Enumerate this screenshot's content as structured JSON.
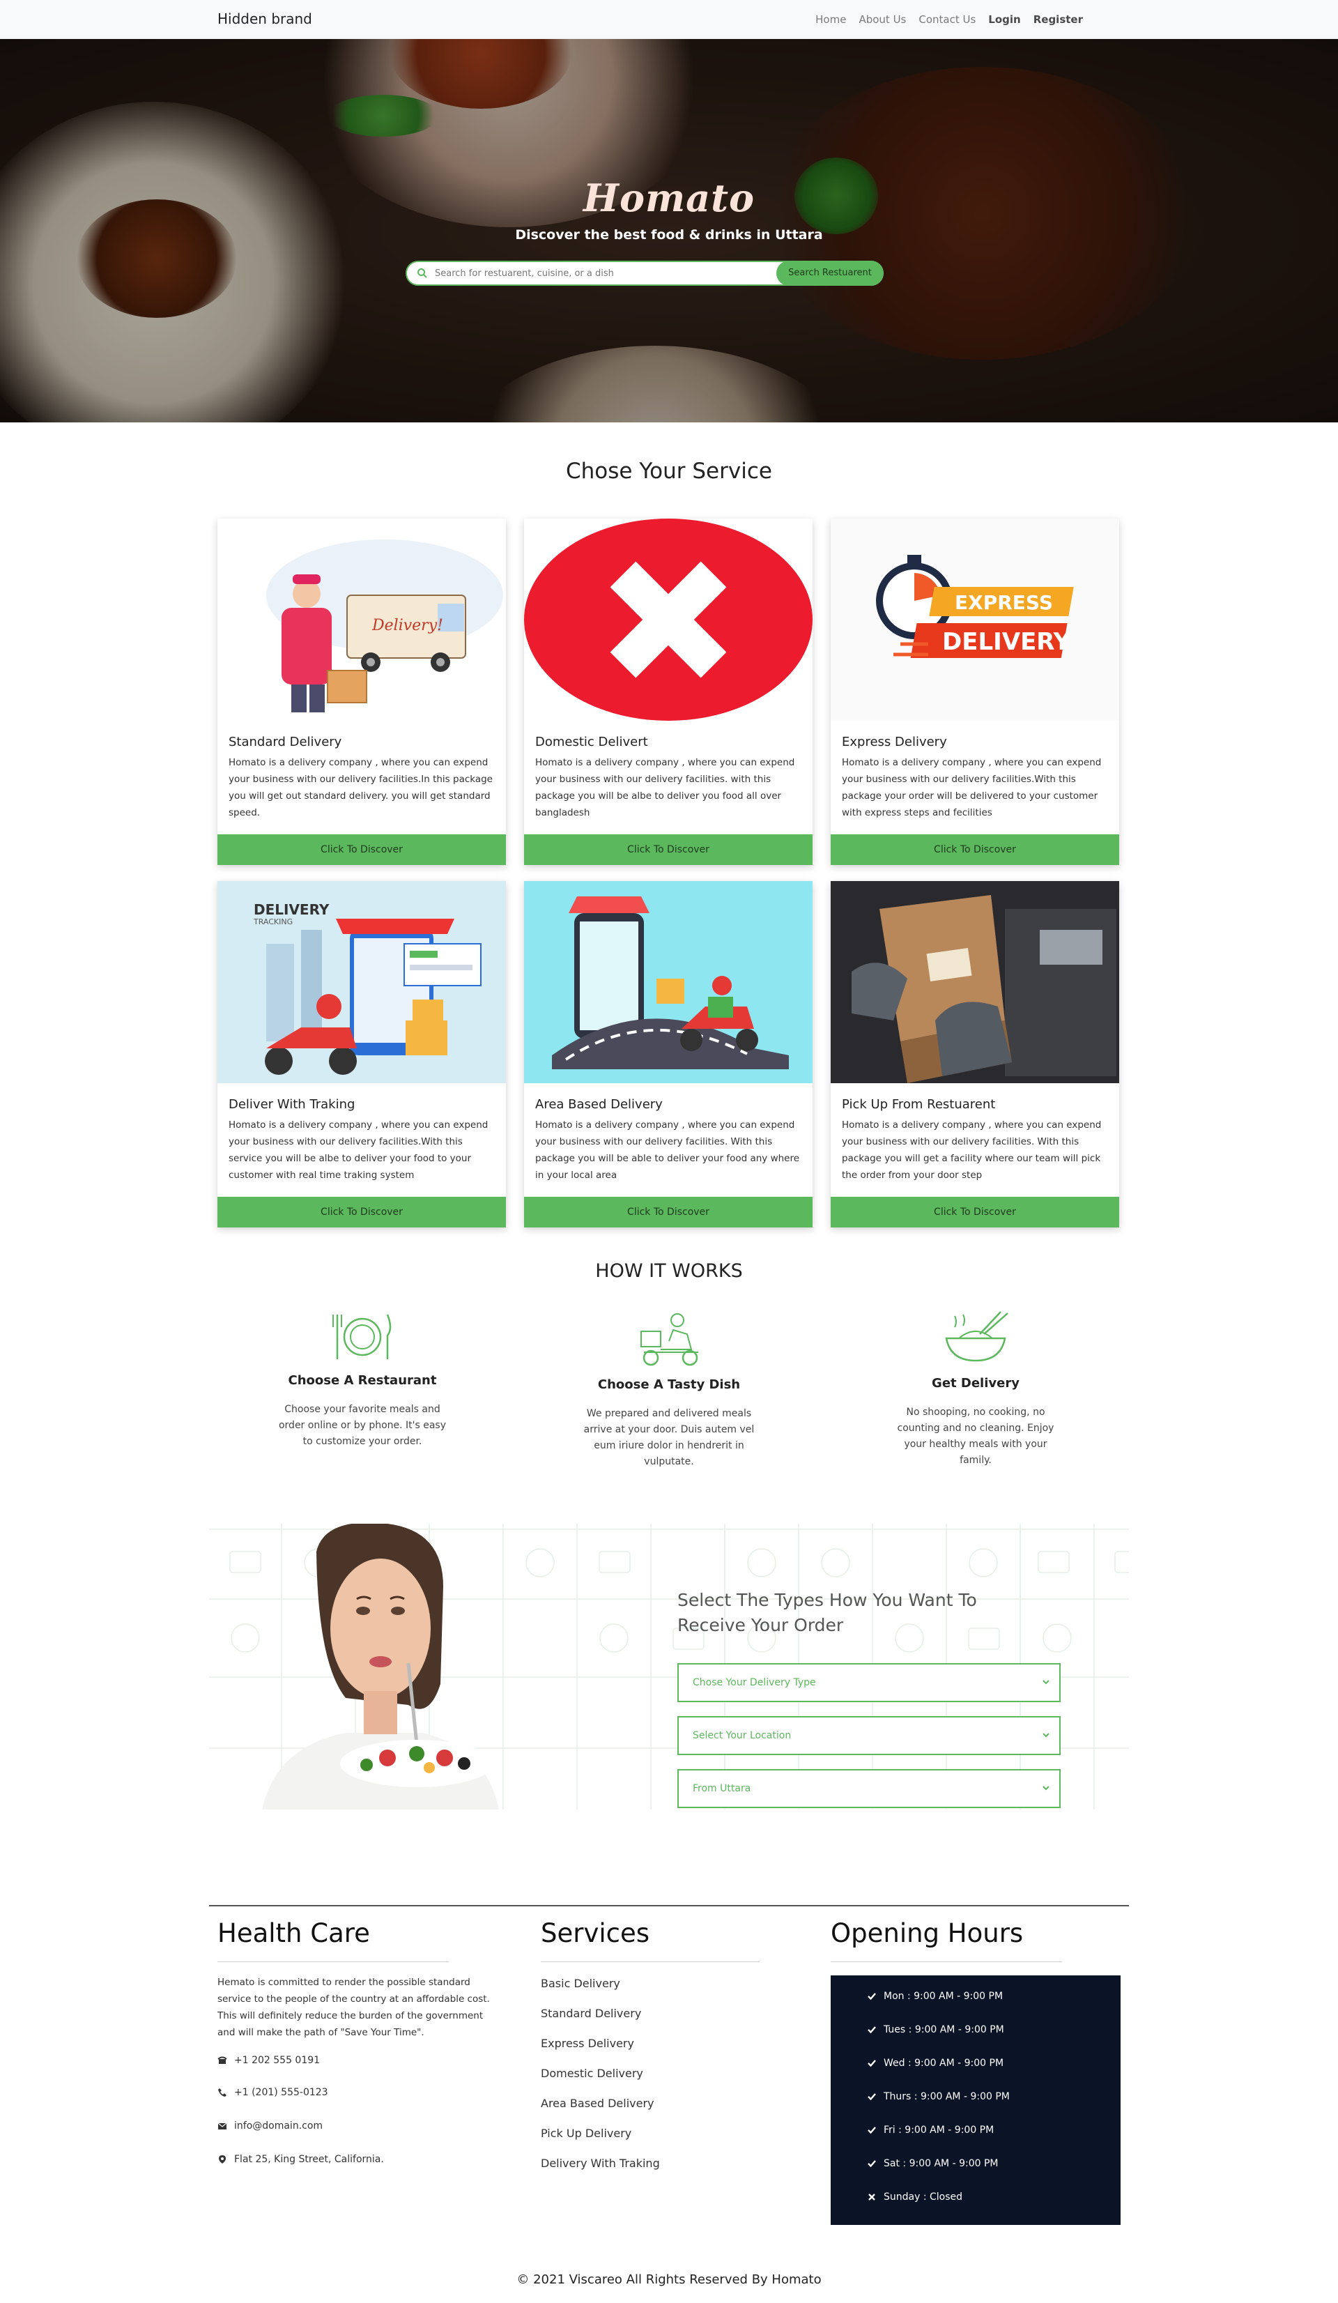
{
  "nav": {
    "brand": "Hidden brand",
    "links": [
      "Home",
      "About Us",
      "Contact Us",
      "Login",
      "Register"
    ]
  },
  "hero": {
    "title": "Homato",
    "subtitle": "Discover the best food & drinks in Uttara",
    "search_placeholder": "Search for restuarent, cuisine, or a dish",
    "search_button": "Search Restuarent"
  },
  "services": {
    "title": "Chose Your Service",
    "cards": [
      {
        "title": "Standard Delivery",
        "desc": "Homato is a delivery company , where you can expend your business with our delivery facilities.In this package you will get out standard delivery. you will get standard speed.",
        "button": "Click To Discover",
        "image": "delivery-van-illustration"
      },
      {
        "title": "Domestic Delivert",
        "desc": "Homato is a delivery company , where you can expend your business with our delivery facilities. with this package you will be albe to deliver you food all over bangladesh",
        "button": "Click To Discover",
        "image": "red-cross-icon"
      },
      {
        "title": "Express Delivery",
        "desc": "Homato is a delivery company , where you can expend your business with our delivery facilities.With this package your order will be delivered to your customer with express steps and fecilities",
        "button": "Click To Discover",
        "image": "express-delivery-stopwatch",
        "badge_line1": "EXPRESS",
        "badge_line2": "DELIVERY"
      },
      {
        "title": "Deliver With Traking",
        "desc": "Homato is a delivery company , where you can expend your business with our delivery facilities.With this service you will be albe to deliver your food to your customer with real time traking system",
        "button": "Click To Discover",
        "image": "delivery-tracking-illustration",
        "badge_line1": "DELIVERY",
        "badge_line2": "TRACKING"
      },
      {
        "title": "Area Based Delivery",
        "desc": "Homato is a delivery company , where you can expend your business with our delivery facilities. With this package you will be able to deliver your food any where in your local area",
        "button": "Click To Discover",
        "image": "scooter-map-illustration"
      },
      {
        "title": "Pick Up From Restuarent",
        "desc": "Homato is a delivery company , where you can expend your business with our delivery facilities. With this package you will get a facility where our team will pick the order from your door step",
        "button": "Click To Discover",
        "image": "package-pickup-photo"
      }
    ]
  },
  "how": {
    "title": "HOW IT WORKS",
    "steps": [
      {
        "title": "Choose A Restaurant",
        "desc": "Choose your favorite meals and order online or by phone. It's easy to customize your order.",
        "icon": "plate-cutlery-icon"
      },
      {
        "title": "Choose A Tasty Dish",
        "desc": "We prepared and delivered meals arrive at your door. Duis autem vel eum iriure dolor in hendrerit in vulputate.",
        "icon": "delivery-scooter-icon"
      },
      {
        "title": "Get Delivery",
        "desc": "No shooping, no cooking, no counting and no cleaning. Enjoy your healthy meals with your family.",
        "icon": "bowl-chopsticks-icon"
      }
    ]
  },
  "order": {
    "title": "Select The Types How You Want To Receive Your Order",
    "selects": [
      "Chose Your Delivery Type",
      "Select Your Location",
      "From Uttara"
    ]
  },
  "footer": {
    "about": {
      "heading": "Health Care",
      "text": "Hemato is committed to render the possible standard service to the people of the country at an affordable cost. This will definitely reduce the burden of the government and will make the path of \"Save Your Time\".",
      "contacts": [
        {
          "icon": "telephone-icon",
          "text": "+1 202 555 0191"
        },
        {
          "icon": "phone-icon",
          "text": "+1 (201) 555-0123"
        },
        {
          "icon": "envelope-icon",
          "text": "info@domain.com"
        },
        {
          "icon": "map-marker-icon",
          "text": "Flat 25, King Street, California."
        }
      ]
    },
    "services": {
      "heading": "Services",
      "items": [
        "Basic Delivery",
        "Standard Delivery",
        "Express Delivery",
        "Domestic Delivery",
        "Area Based Delivery",
        "Pick Up Delivery",
        "Delivery With Traking"
      ]
    },
    "hours": {
      "heading": "Opening Hours",
      "rows": [
        {
          "text": "Mon : 9:00 AM - 9:00 PM",
          "icon": "check-icon"
        },
        {
          "text": "Tues : 9:00 AM - 9:00 PM",
          "icon": "check-icon"
        },
        {
          "text": "Wed : 9:00 AM - 9:00 PM",
          "icon": "check-icon"
        },
        {
          "text": "Thurs : 9:00 AM - 9:00 PM",
          "icon": "check-icon"
        },
        {
          "text": "Fri : 9:00 AM - 9:00 PM",
          "icon": "check-icon"
        },
        {
          "text": "Sat : 9:00 AM - 9:00 PM",
          "icon": "check-icon"
        },
        {
          "text": "Sunday : Closed",
          "icon": "times-icon"
        }
      ]
    },
    "copyright": "© 2021 Viscareo All Rights Reserved By Homato"
  },
  "colors": {
    "accent": "#5cb85c",
    "hours_bg": "#0b1326",
    "navbar_bg": "#f8f9fa",
    "x_red": "#ec1c2e"
  }
}
